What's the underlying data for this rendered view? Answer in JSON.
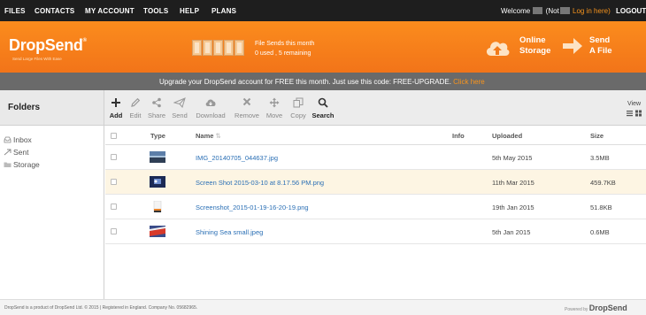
{
  "topnav": {
    "items": [
      "FILES",
      "CONTACTS",
      "MY ACCOUNT",
      "TOOLS",
      "HELP",
      "PLANS"
    ],
    "welcome_prefix": "Welcome",
    "not_text": "(Not",
    "login_text": "Log in here)",
    "logout": "LOGOUT"
  },
  "header": {
    "logo": "DropSend",
    "logo_mark": "®",
    "tagline": "Send Large Files With Ease",
    "sends_label": "File Sends this month",
    "sends_count": "0 used , 5 remaining",
    "sends_used": 0,
    "sends_total": 5,
    "storage_button": [
      "Online",
      "Storage"
    ],
    "send_button": [
      "Send",
      "A File"
    ]
  },
  "upgrade": {
    "message": "Upgrade your DropSend account for  FREE  this month. Just use this code: FREE-UPGRADE.",
    "link": "Click here"
  },
  "folders_title": "Folders",
  "toolbar": {
    "tools": [
      {
        "label": "Add",
        "icon": "plus-icon",
        "active": true
      },
      {
        "label": "Edit",
        "icon": "pencil-icon",
        "active": false
      },
      {
        "label": "Share",
        "icon": "share-icon",
        "active": false
      },
      {
        "label": "Send",
        "icon": "paper-plane-icon",
        "active": false
      },
      {
        "label": "Download",
        "icon": "cloud-download-icon",
        "active": false
      },
      {
        "label": "Remove",
        "icon": "x-icon",
        "active": false
      },
      {
        "label": "Move",
        "icon": "move-arrows-icon",
        "active": false
      },
      {
        "label": "Copy",
        "icon": "copy-icon",
        "active": false
      },
      {
        "label": "Search",
        "icon": "magnifier-icon",
        "active": true
      }
    ],
    "view_label": "View"
  },
  "sidebar": {
    "items": [
      {
        "label": "Inbox",
        "icon": "inbox-tray-icon"
      },
      {
        "label": "Sent",
        "icon": "sent-arrow-icon"
      },
      {
        "label": "Storage",
        "icon": "folder-icon"
      }
    ]
  },
  "table": {
    "columns": {
      "type": "Type",
      "name": "Name",
      "info": "Info",
      "uploaded": "Uploaded",
      "size": "Size"
    },
    "rows": [
      {
        "name": "IMG_20140705_044637.jpg",
        "uploaded": "5th May 2015",
        "size": "3.5MB",
        "selected": false
      },
      {
        "name": "Screen Shot 2015-03-10 at 8.17.56 PM.png",
        "uploaded": "11th Mar 2015",
        "size": "459.7KB",
        "selected": true
      },
      {
        "name": "Screenshot_2015-01-19-16-20-19.png",
        "uploaded": "19th Jan 2015",
        "size": "51.8KB",
        "selected": false
      },
      {
        "name": "Shining Sea small.jpeg",
        "uploaded": "5th Jan 2015",
        "size": "0.6MB",
        "selected": false
      }
    ]
  },
  "footer": {
    "copyright": "DropSend is a product of DropSend Ltd. © 2015 | Registered in England. Company No. 05682965.",
    "powered_by": "Powered by",
    "powered_brand": "DropSend"
  },
  "colors": {
    "accent": "#f7941d",
    "link": "#2a6fb5",
    "dark": "#1e1e1e",
    "upgrade_bar": "#6a6a6a"
  }
}
